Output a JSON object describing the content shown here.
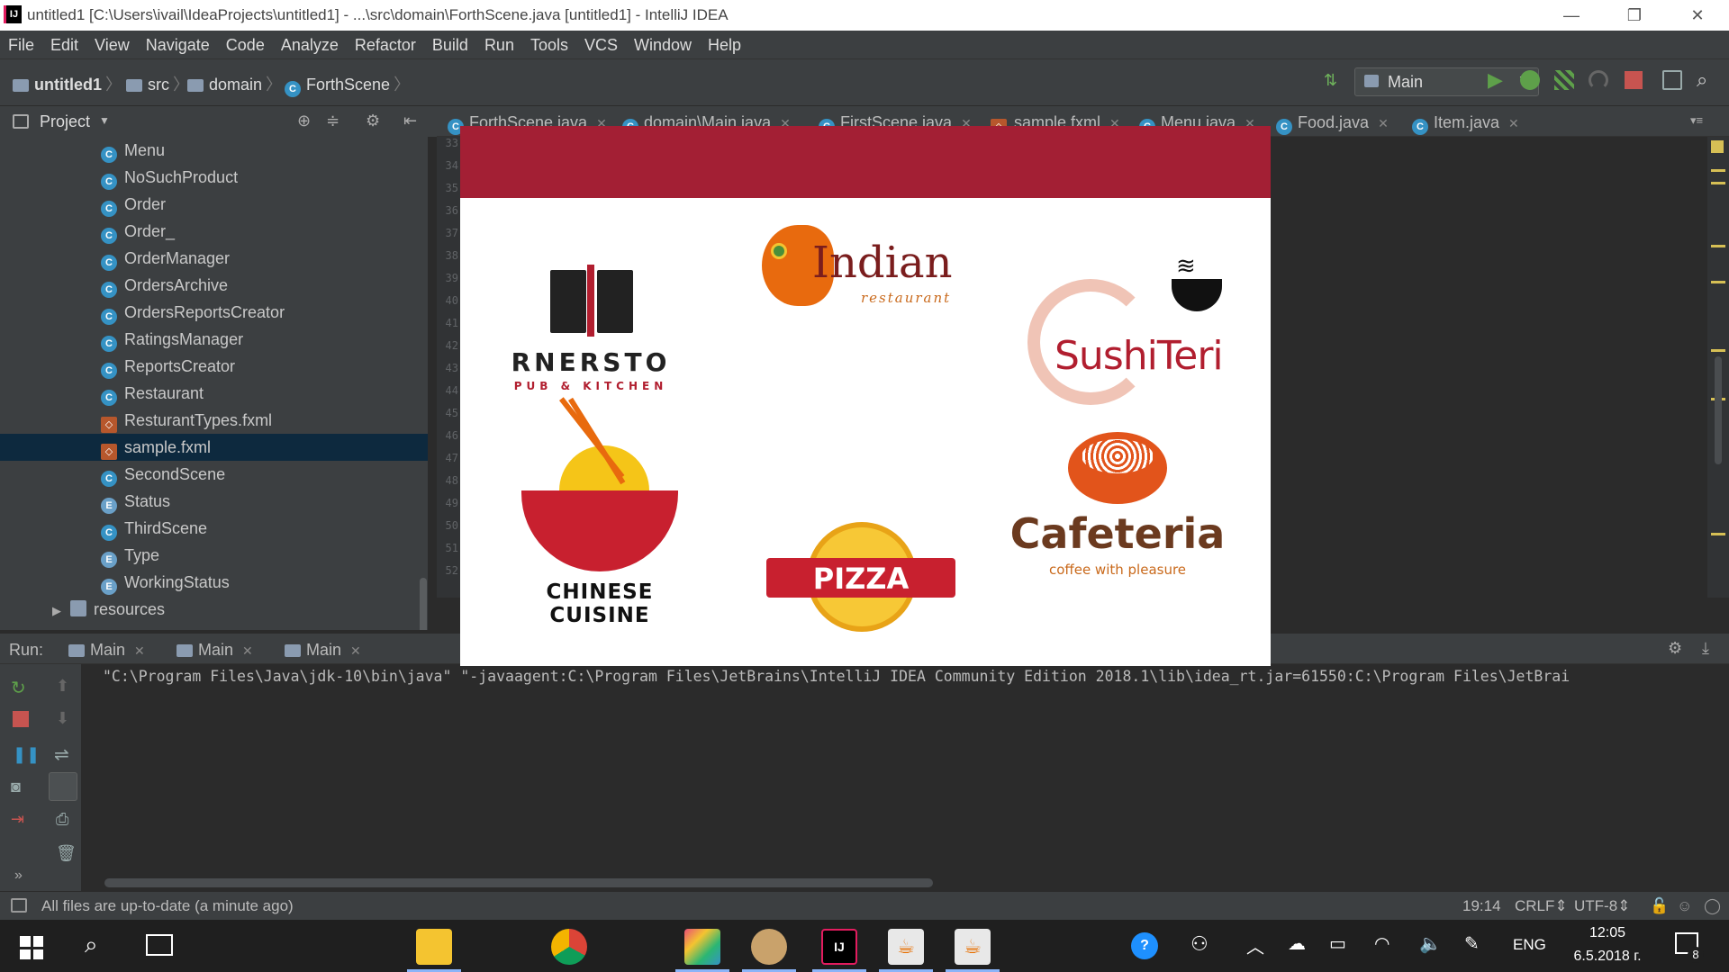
{
  "window": {
    "title": "untitled1 [C:\\Users\\ivail\\IdeaProjects\\untitled1] - ...\\src\\domain\\ForthScene.java [untitled1] - IntelliJ IDEA",
    "min": "—",
    "max": "❐",
    "close": "✕"
  },
  "menu": [
    "File",
    "Edit",
    "View",
    "Navigate",
    "Code",
    "Analyze",
    "Refactor",
    "Build",
    "Run",
    "Tools",
    "VCS",
    "Window",
    "Help"
  ],
  "breadcrumb": {
    "project": "untitled1",
    "src": "src",
    "domain": "domain",
    "file": "ForthScene"
  },
  "run_config": "Main",
  "project_panel": {
    "title": "Project",
    "items": [
      {
        "label": "Menu",
        "type": "C"
      },
      {
        "label": "NoSuchProduct",
        "type": "C"
      },
      {
        "label": "Order",
        "type": "C"
      },
      {
        "label": "Order_",
        "type": "C"
      },
      {
        "label": "OrderManager",
        "type": "C"
      },
      {
        "label": "OrdersArchive",
        "type": "C"
      },
      {
        "label": "OrdersReportsCreator",
        "type": "C"
      },
      {
        "label": "RatingsManager",
        "type": "C"
      },
      {
        "label": "ReportsCreator",
        "type": "C"
      },
      {
        "label": "Restaurant",
        "type": "C"
      },
      {
        "label": "ResturantTypes.fxml",
        "type": "F"
      },
      {
        "label": "sample.fxml",
        "type": "F"
      },
      {
        "label": "SecondScene",
        "type": "C"
      },
      {
        "label": "Status",
        "type": "E"
      },
      {
        "label": "ThirdScene",
        "type": "C"
      },
      {
        "label": "Type",
        "type": "E"
      },
      {
        "label": "WorkingStatus",
        "type": "E"
      },
      {
        "label": "resources",
        "type": "D"
      }
    ]
  },
  "editor_tabs": [
    "ForthScene.java",
    "domain\\Main.java",
    "FirstScene.java",
    "sample.fxml",
    "Menu.java",
    "Food.java",
    "Item.java"
  ],
  "line_numbers": [
    "33",
    "34",
    "35",
    "36",
    "37",
    "38",
    "39",
    "40",
    "41",
    "42",
    "43",
    "44",
    "45",
    "46",
    "47",
    "48",
    "49",
    "50",
    "51",
    "52"
  ],
  "app_window": {
    "logos": {
      "pub_title": "RNERSTO",
      "pub_sub": "PUB & KITCHEN",
      "indian_title": "Indian",
      "indian_sub": "restaurant",
      "sushi_title": "SushiTeri",
      "chinese_title": "CHINESE CUISINE",
      "pizza_title": "PIZZA",
      "cafe_title": "Cafeteria",
      "cafe_sub": "coffee with pleasure"
    }
  },
  "run_panel": {
    "label": "Run:",
    "tabs": [
      "Main",
      "Main",
      "Main"
    ],
    "command": "\"C:\\Program Files\\Java\\jdk-10\\bin\\java\" \"-javaagent:C:\\Program Files\\JetBrains\\IntelliJ IDEA Community Edition 2018.1\\lib\\idea_rt.jar=61550:C:\\Program Files\\JetBrai"
  },
  "status_bar": {
    "message": "All files are up-to-date (a minute ago)",
    "position": "19:14",
    "line_sep": "CRLF⇕",
    "encoding": "UTF-8⇕"
  },
  "taskbar": {
    "lang": "ENG",
    "time": "12:05",
    "date": "6.5.2018 г.",
    "notif_count": "8"
  },
  "colors": {
    "accent_red": "#a31f34",
    "ide_bg": "#2b2b2b",
    "panel_bg": "#3c3f41",
    "selection": "#0d293e"
  }
}
